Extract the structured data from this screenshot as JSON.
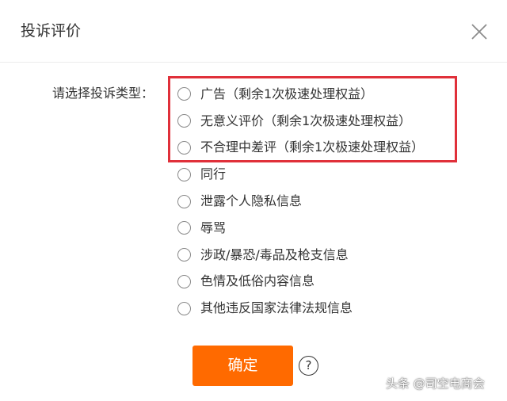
{
  "dialog": {
    "title": "投诉评价"
  },
  "form": {
    "label": "请选择投诉类型：",
    "options": [
      {
        "label": "广告（剩余1次极速处理权益）",
        "selected": false
      },
      {
        "label": "无意义评价（剩余1次极速处理权益）",
        "selected": false
      },
      {
        "label": "不合理中差评（剩余1次极速处理权益）",
        "selected": false
      },
      {
        "label": "同行",
        "selected": false
      },
      {
        "label": "泄露个人隐私信息",
        "selected": false
      },
      {
        "label": "辱骂",
        "selected": false
      },
      {
        "label": "涉政/暴恐/毒品及枪支信息",
        "selected": false
      },
      {
        "label": "色情及低俗内容信息",
        "selected": false
      },
      {
        "label": "其他违反国家法律法规信息",
        "selected": false
      }
    ]
  },
  "actions": {
    "confirm_label": "确定",
    "help_symbol": "?"
  },
  "watermark": {
    "text": "头条 @司空电商会"
  },
  "colors": {
    "accent": "#ff6a00",
    "highlight_border": "#e0303a",
    "text": "#333333"
  }
}
